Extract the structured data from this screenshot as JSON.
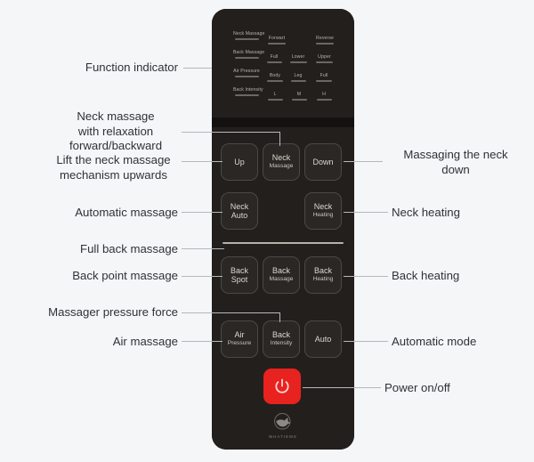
{
  "device": {
    "name": "massage-chair-remote",
    "body_color": "#1b1917",
    "panel_color": "#231f1d",
    "accent_color": "#e8221f",
    "brand_text": "WHATIEMS"
  },
  "indicator_panel": {
    "title": "Function indicator",
    "rows": [
      {
        "label": "Neck\nMassage",
        "options": [
          "Forwart",
          "",
          "Reverse"
        ]
      },
      {
        "label": "Back\nMassage",
        "options": [
          "Full",
          "Lower",
          "Upper"
        ]
      },
      {
        "label": "Air\nPressure",
        "options": [
          "Body",
          "Leg",
          "Full"
        ]
      },
      {
        "label": "Back\nIntensity",
        "options": [
          "L",
          "M",
          "H"
        ]
      }
    ]
  },
  "buttons": [
    {
      "id": "up",
      "line1": "Up",
      "line2": ""
    },
    {
      "id": "neck-massage",
      "line1": "Neck",
      "line2": "Massage"
    },
    {
      "id": "down",
      "line1": "Down",
      "line2": ""
    },
    {
      "id": "neck-auto",
      "line1": "Neck",
      "line2": "Auto"
    },
    {
      "id": "neck-heating",
      "line1": "Neck",
      "line2": "Heating"
    },
    {
      "id": "back-spot",
      "line1": "Back",
      "line2": "Spot"
    },
    {
      "id": "back-massage",
      "line1": "Back",
      "line2": "Massage"
    },
    {
      "id": "back-heating",
      "line1": "Back",
      "line2": "Heating"
    },
    {
      "id": "air-pressure",
      "line1": "Air",
      "line2": "Pressure"
    },
    {
      "id": "back-intensity",
      "line1": "Back",
      "line2": "Intensity"
    },
    {
      "id": "auto",
      "line1": "Auto",
      "line2": ""
    }
  ],
  "power_button": {
    "label": "",
    "icon": "power-icon",
    "color": "#e8221f"
  },
  "callouts_left": [
    {
      "id": "function-indicator",
      "text": "Function indicator"
    },
    {
      "id": "neck-massage-relax",
      "text": "Neck massage\nwith relaxation\nforward/backward"
    },
    {
      "id": "lift-neck",
      "text": "Lift the neck massage\nmechanism upwards"
    },
    {
      "id": "automatic-massage",
      "text": "Automatic massage"
    },
    {
      "id": "full-back-massage",
      "text": "Full back massage"
    },
    {
      "id": "back-point-massage",
      "text": "Back point massage"
    },
    {
      "id": "massager-pressure-force",
      "text": "Massager pressure force"
    },
    {
      "id": "air-massage",
      "text": "Air massage"
    }
  ],
  "callouts_right": [
    {
      "id": "massaging-neck-down",
      "text": "Massaging the neck\ndown"
    },
    {
      "id": "neck-heating",
      "text": "Neck heating"
    },
    {
      "id": "back-heating",
      "text": "Back heating"
    },
    {
      "id": "automatic-mode",
      "text": "Automatic mode"
    },
    {
      "id": "power-on-off",
      "text": "Power on/off"
    }
  ]
}
